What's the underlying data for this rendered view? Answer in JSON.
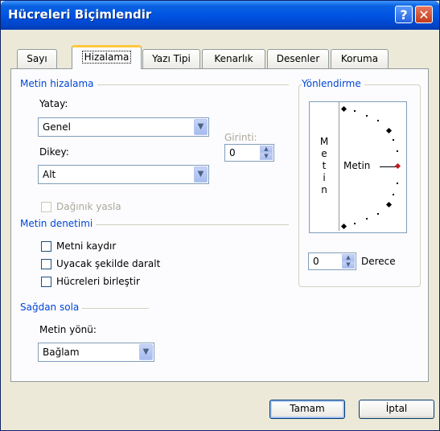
{
  "window": {
    "title": "Hücreleri Biçimlendir",
    "help_label": "?",
    "close_label": "✕"
  },
  "tabs": [
    {
      "label": "Sayı"
    },
    {
      "label": "Hizalama"
    },
    {
      "label": "Yazı Tipi"
    },
    {
      "label": "Kenarlık"
    },
    {
      "label": "Desenler"
    },
    {
      "label": "Koruma"
    }
  ],
  "text_alignment": {
    "group_label": "Metin hizalama",
    "horizontal_label": "Yatay:",
    "horizontal_value": "Genel",
    "indent_label": "Girinti:",
    "indent_value": "0",
    "vertical_label": "Dikey:",
    "vertical_value": "Alt",
    "justify_distributed_label": "Dağınık yasla"
  },
  "text_control": {
    "group_label": "Metin denetimi",
    "wrap_label": "Metni kaydır",
    "shrink_label": "Uyacak şekilde daralt",
    "merge_label": "Hücreleri birleştir"
  },
  "rtl": {
    "group_label": "Sağdan sola",
    "direction_label": "Metin yönü:",
    "direction_value": "Bağlam"
  },
  "orientation": {
    "group_label": "Yönlendirme",
    "vertical_text": "M e t i n",
    "horizontal_text": "Metin",
    "degree_value": "0",
    "degree_label": "Derece"
  },
  "buttons": {
    "ok": "Tamam",
    "cancel": "İptal"
  },
  "colors": {
    "title_bar": "#0054e3",
    "group_label": "#0046d5",
    "active_tab_accent": "#ffc83c",
    "dialog_bg": "#ece9d8"
  }
}
